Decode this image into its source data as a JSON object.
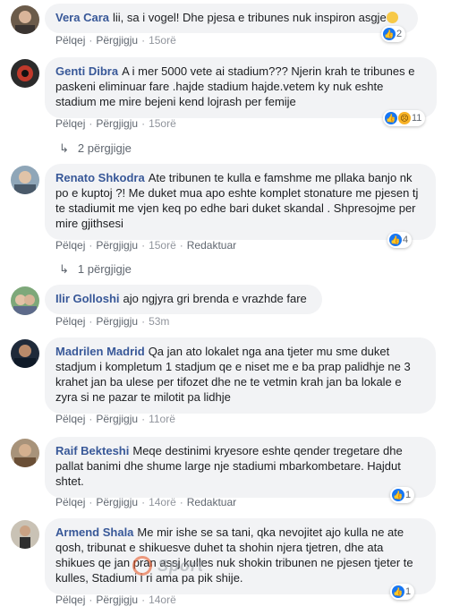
{
  "actions": {
    "like": "Pëlqej",
    "reply": "Përgjigju",
    "edited": "Redaktuar"
  },
  "comments": [
    {
      "author": "Vera Cara",
      "text": "lii, sa i vogel! Dhe pjesa e tribunes nuk inspiron asgje",
      "time": "15orë",
      "reaction_count": "2"
    },
    {
      "author": "Genti Dibra",
      "text": "A i mer 5000 vete ai stadium??? Njerin krah te tribunes e paskeni eliminuar fare .hajde stadium hajde.vetem ky nuk eshte stadium me mire bejeni kend lojrash per femije",
      "time": "15orë",
      "reaction_count": "11",
      "replies_label": "2 përgjigje"
    },
    {
      "author": "Renato Shkodra",
      "text": "Ate tribunen te kulla e famshme me pllaka banjo nk po e kuptoj ?! Me duket mua apo eshte komplet stonature me pjesen tj te stadiumit  me vjen keq po edhe bari duket skandal . Shpresojme per mire gjithsesi",
      "time": "15orë",
      "reaction_count": "4",
      "replies_label": "1 përgjigje"
    },
    {
      "author": "Ilir Golloshi",
      "text": "ajo ngjyra gri brenda e vrazhde fare",
      "time": "53m"
    },
    {
      "author": "Madrilen Madrid",
      "text": "Qa jan ato lokalet nga ana tjeter mu sme duket stadjum i kompletum 1 stadjum qe e niset me e ba prap palidhje ne 3 krahet jan ba ulese per tifozet dhe ne te vetmin krah jan ba lokale e zyra si ne pazar te milotit pa lidhje",
      "time": "11orë"
    },
    {
      "author": "Raif Bekteshi",
      "text": "Meqe destinimi kryesore eshte qender tregetare dhe pallat banimi dhe shume large nje stadiumi mbarkombetare. Hajdut shtet.",
      "time": "14orë",
      "reaction_count": "1"
    },
    {
      "author": "Armend Shala",
      "text": "Me mir ishe se sa tani, qka nevojitet ajo kulla ne ate qosh, tribunat e shikuesve duhet ta shohin njera tjetren, dhe ata shikues qe jan pran assj kulles nuk shokin tribunen ne pjesen tjeter te kulles, Stadiumi i ri ama pa pik shije.",
      "time": "14orë",
      "reaction_count": "1"
    }
  ],
  "watermark": "Sport"
}
